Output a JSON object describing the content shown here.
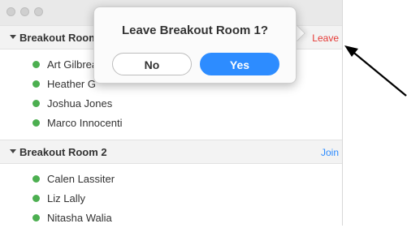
{
  "rooms": [
    {
      "title": "Breakout Room 1",
      "action": "Leave",
      "action_color": "#e53935",
      "participants": [
        "Art Gilbreath",
        "Heather G",
        "Joshua Jones",
        "Marco Innocenti"
      ]
    },
    {
      "title": "Breakout Room 2",
      "action": "Join",
      "action_color": "#2d8cff",
      "participants": [
        "Calen Lassiter",
        "Liz Lally",
        "Nitasha Walia"
      ]
    }
  ],
  "dialog": {
    "title": "Leave Breakout Room 1?",
    "no_label": "No",
    "yes_label": "Yes"
  },
  "colors": {
    "online_dot": "#4caf50",
    "accent": "#2d8cff"
  },
  "icons": {
    "annotation": "arrow-icon"
  }
}
